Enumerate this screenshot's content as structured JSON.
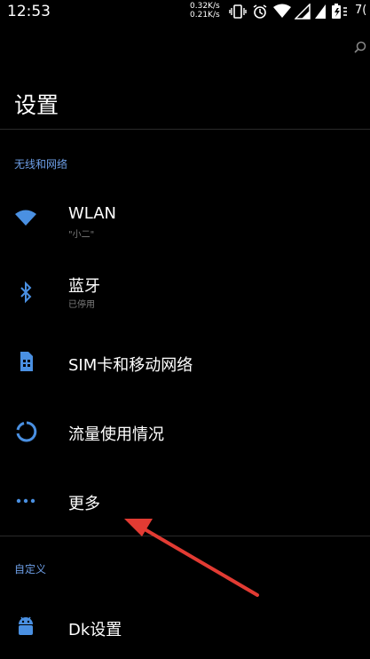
{
  "status_bar": {
    "time": "12:53",
    "net_up": "0.32K/s",
    "net_down": "0.21K/s",
    "battery": "7("
  },
  "header": {
    "title": "设置"
  },
  "sections": [
    {
      "title": "无线和网络",
      "items": [
        {
          "icon": "wifi-icon",
          "label": "WLAN",
          "sub": "\"小二\""
        },
        {
          "icon": "bluetooth-icon",
          "label": "蓝牙",
          "sub": "已停用"
        },
        {
          "icon": "sim-card-icon",
          "label": "SIM卡和移动网络"
        },
        {
          "icon": "data-usage-icon",
          "label": "流量使用情况"
        },
        {
          "icon": "more-icon",
          "label": "更多"
        }
      ]
    },
    {
      "title": "自定义",
      "items": [
        {
          "icon": "android-icon",
          "label": "Dk设置"
        }
      ]
    }
  ],
  "colors": {
    "accent": "#4a90e2",
    "section_header": "#6d9ee6",
    "annotation_arrow": "#e23b33"
  }
}
